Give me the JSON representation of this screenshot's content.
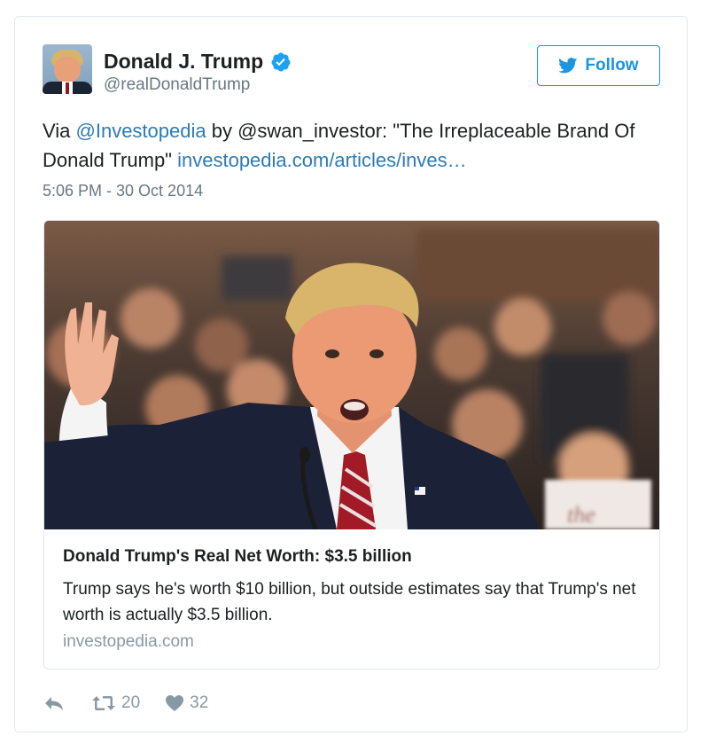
{
  "author": {
    "name": "Donald J. Trump",
    "handle": "@realDonaldTrump",
    "verified": true
  },
  "follow_button": {
    "label": "Follow"
  },
  "tweet": {
    "prefix": "Via ",
    "mention_1": "@Investopedia",
    "middle": " by @swan_investor: \"The Irreplaceable Brand Of Donald Trump\" ",
    "link": "investopedia.com/articles/inves…",
    "timestamp": "5:06 PM - 30 Oct 2014"
  },
  "card": {
    "title": "Donald Trump's Real Net Worth: $3.5 billion",
    "description": "Trump says he's worth $10 billion, but outside estimates say that Trump's net worth is actually $3.5 billion.",
    "domain": "investopedia.com",
    "image_sign_text": "the"
  },
  "actions": {
    "reply_icon": "reply-icon",
    "retweet_count": "20",
    "like_count": "32"
  },
  "colors": {
    "link": "#2b7bb9",
    "twitter_blue": "#1b95e0",
    "muted": "#697882",
    "action_gray": "#8899a6",
    "border": "#e1e8ed"
  }
}
